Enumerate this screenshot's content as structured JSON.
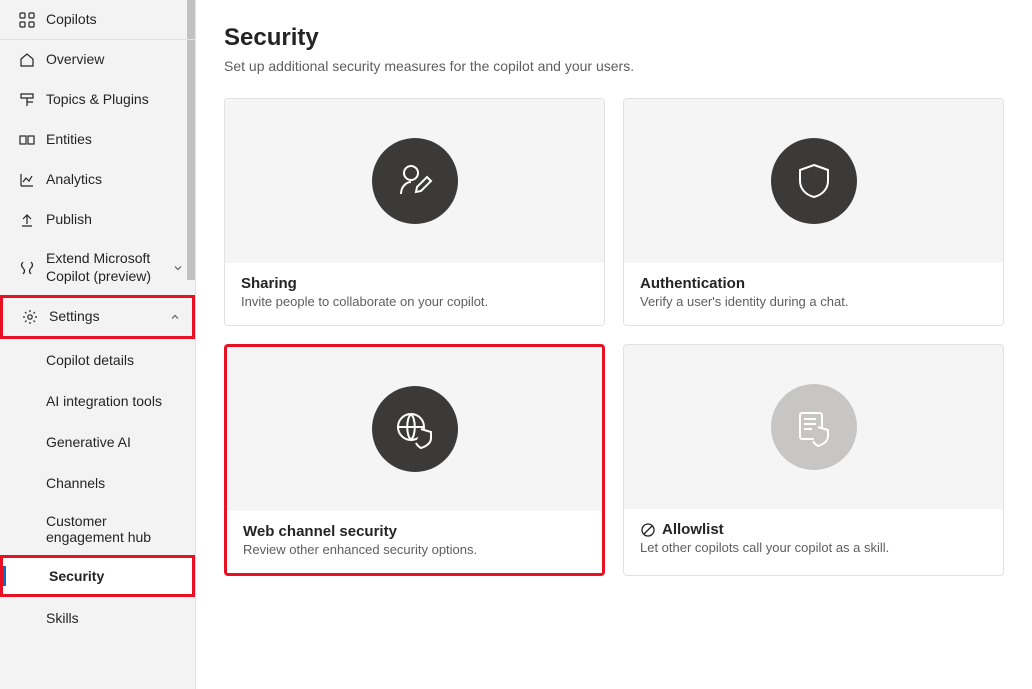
{
  "sidebar": {
    "copilots": "Copilots",
    "overview": "Overview",
    "topics_plugins": "Topics & Plugins",
    "entities": "Entities",
    "analytics": "Analytics",
    "publish": "Publish",
    "extend": "Extend Microsoft Copilot (preview)",
    "settings": "Settings",
    "sub": {
      "copilot_details": "Copilot details",
      "ai_integration": "AI integration tools",
      "generative_ai": "Generative AI",
      "channels": "Channels",
      "customer_hub": "Customer engagement hub",
      "security": "Security",
      "skills": "Skills"
    }
  },
  "page": {
    "title": "Security",
    "subtitle": "Set up additional security measures for the copilot and your users."
  },
  "cards": {
    "sharing": {
      "title": "Sharing",
      "desc": "Invite people to collaborate on your copilot."
    },
    "authentication": {
      "title": "Authentication",
      "desc": "Verify a user's identity during a chat."
    },
    "web_channel": {
      "title": "Web channel security",
      "desc": "Review other enhanced security options."
    },
    "allowlist": {
      "title": "Allowlist",
      "desc": "Let other copilots call your copilot as a skill."
    }
  }
}
